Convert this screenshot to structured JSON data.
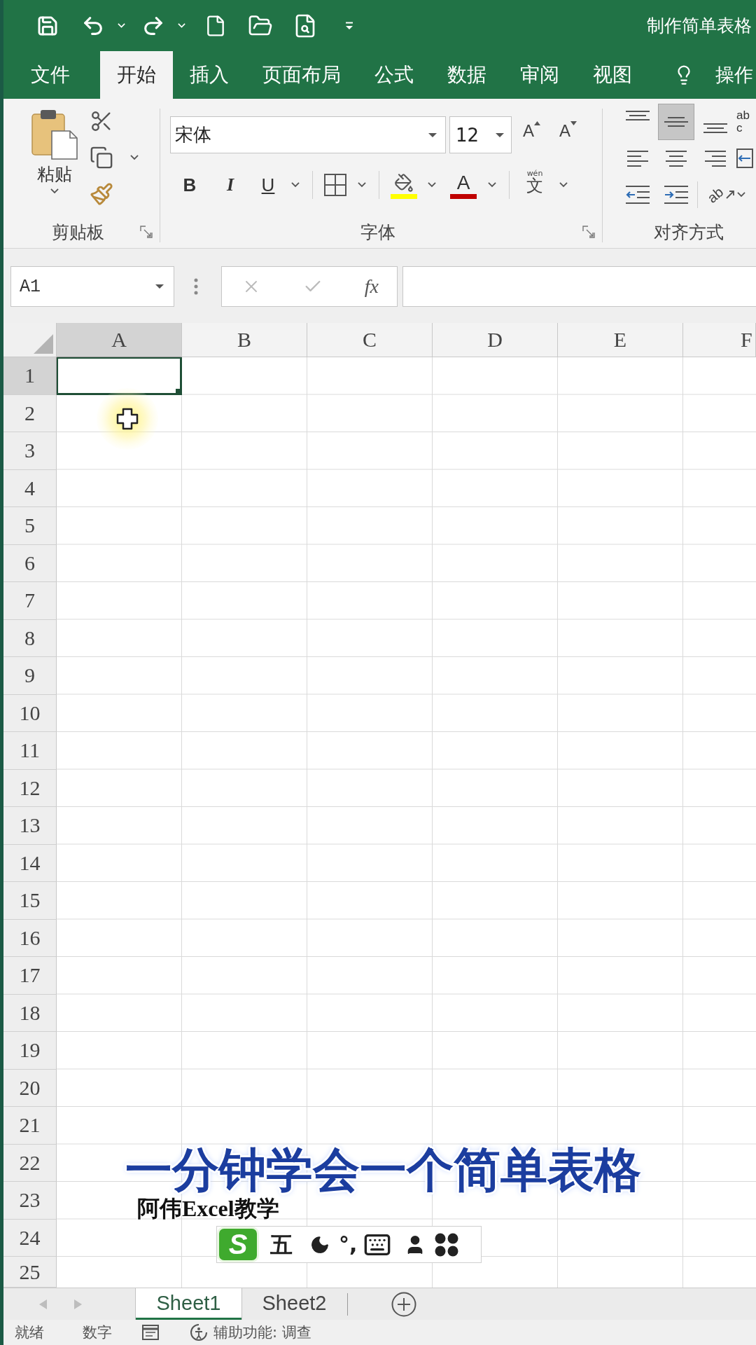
{
  "window": {
    "title": "制作简单表格"
  },
  "ribbon_tabs": [
    {
      "label": "文件",
      "selected": false
    },
    {
      "label": "开始",
      "selected": true
    },
    {
      "label": "插入",
      "selected": false
    },
    {
      "label": "页面布局",
      "selected": false
    },
    {
      "label": "公式",
      "selected": false
    },
    {
      "label": "数据",
      "selected": false
    },
    {
      "label": "审阅",
      "selected": false
    },
    {
      "label": "视图",
      "selected": false
    }
  ],
  "tell_me": {
    "label": "操作"
  },
  "ribbon": {
    "clipboard": {
      "paste_label": "粘贴",
      "group_label": "剪贴板"
    },
    "font": {
      "font_name": "宋体",
      "font_size": "12",
      "grow_label": "A",
      "shrink_label": "A",
      "bold_label": "B",
      "italic_label": "I",
      "underline_label": "U",
      "fill_color": {
        "color": "#ffff00"
      },
      "font_color": {
        "label": "A",
        "color": "#c00000"
      },
      "phonetic": {
        "pinyin": "wén",
        "label": "文"
      },
      "group_label": "字体"
    },
    "alignment": {
      "vertical": [
        {
          "kind": "top",
          "selected": false
        },
        {
          "kind": "middle",
          "selected": true
        },
        {
          "kind": "bottom",
          "selected": false
        }
      ],
      "horizontal": [
        {
          "kind": "left",
          "selected": false
        },
        {
          "kind": "center",
          "selected": false
        },
        {
          "kind": "right",
          "selected": false
        }
      ],
      "wrap_text": "ab\nc",
      "orientation_label": "ab",
      "group_label": "对齐方式"
    }
  },
  "formula_bar": {
    "name_box": "A1",
    "function_label": "fx"
  },
  "sheet": {
    "columns": [
      {
        "label": "A",
        "selected": true
      },
      {
        "label": "B",
        "selected": false
      },
      {
        "label": "C",
        "selected": false
      },
      {
        "label": "D",
        "selected": false
      },
      {
        "label": "E",
        "selected": false
      },
      {
        "label": "F",
        "selected": false
      }
    ],
    "rows": [
      {
        "label": "1",
        "selected": true
      },
      {
        "label": "2",
        "selected": false
      },
      {
        "label": "3",
        "selected": false
      },
      {
        "label": "4",
        "selected": false
      },
      {
        "label": "5",
        "selected": false
      },
      {
        "label": "6",
        "selected": false
      },
      {
        "label": "7",
        "selected": false
      },
      {
        "label": "8",
        "selected": false
      },
      {
        "label": "9",
        "selected": false
      },
      {
        "label": "10",
        "selected": false
      },
      {
        "label": "11",
        "selected": false
      },
      {
        "label": "12",
        "selected": false
      },
      {
        "label": "13",
        "selected": false
      },
      {
        "label": "14",
        "selected": false
      },
      {
        "label": "15",
        "selected": false
      },
      {
        "label": "16",
        "selected": false
      },
      {
        "label": "17",
        "selected": false
      },
      {
        "label": "18",
        "selected": false
      },
      {
        "label": "19",
        "selected": false
      },
      {
        "label": "20",
        "selected": false
      },
      {
        "label": "21",
        "selected": false
      },
      {
        "label": "22",
        "selected": false
      },
      {
        "label": "23",
        "selected": false
      },
      {
        "label": "24",
        "selected": false
      },
      {
        "label": "25",
        "selected": false
      }
    ]
  },
  "overlay": {
    "title": "一分钟学会一个简单表格",
    "subtitle": "阿伟Excel教学"
  },
  "ime_toolbar": {
    "logo": "S",
    "input_mode": "五",
    "punctuation": "°,"
  },
  "sheet_tabs": [
    {
      "label": "Sheet1",
      "selected": true
    },
    {
      "label": "Sheet2",
      "selected": false
    }
  ],
  "status_bar": {
    "ready": "就绪",
    "mode": "数字",
    "accessibility": "辅助功能: 调查"
  }
}
